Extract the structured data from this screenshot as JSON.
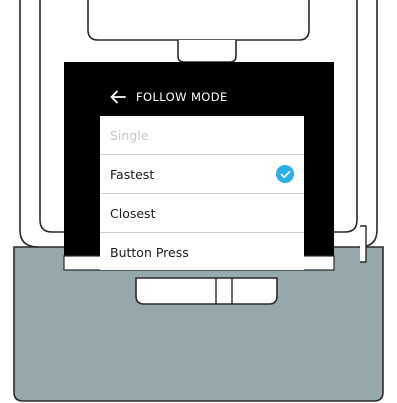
{
  "screen": {
    "title": "FOLLOW MODE",
    "back_icon": "arrow-left-icon",
    "options": [
      {
        "label": "Single",
        "state": "disabled"
      },
      {
        "label": "Fastest",
        "state": "selected"
      },
      {
        "label": "Closest",
        "state": "normal"
      },
      {
        "label": "Button Press",
        "state": "normal"
      }
    ],
    "selected_icon": "check-circle-icon"
  },
  "colors": {
    "device_body": "#97a8ad",
    "device_outline": "#2a2a2a",
    "header_bg": "#000000",
    "accent": "#29aee8",
    "disabled_text": "#c7c7c7"
  }
}
